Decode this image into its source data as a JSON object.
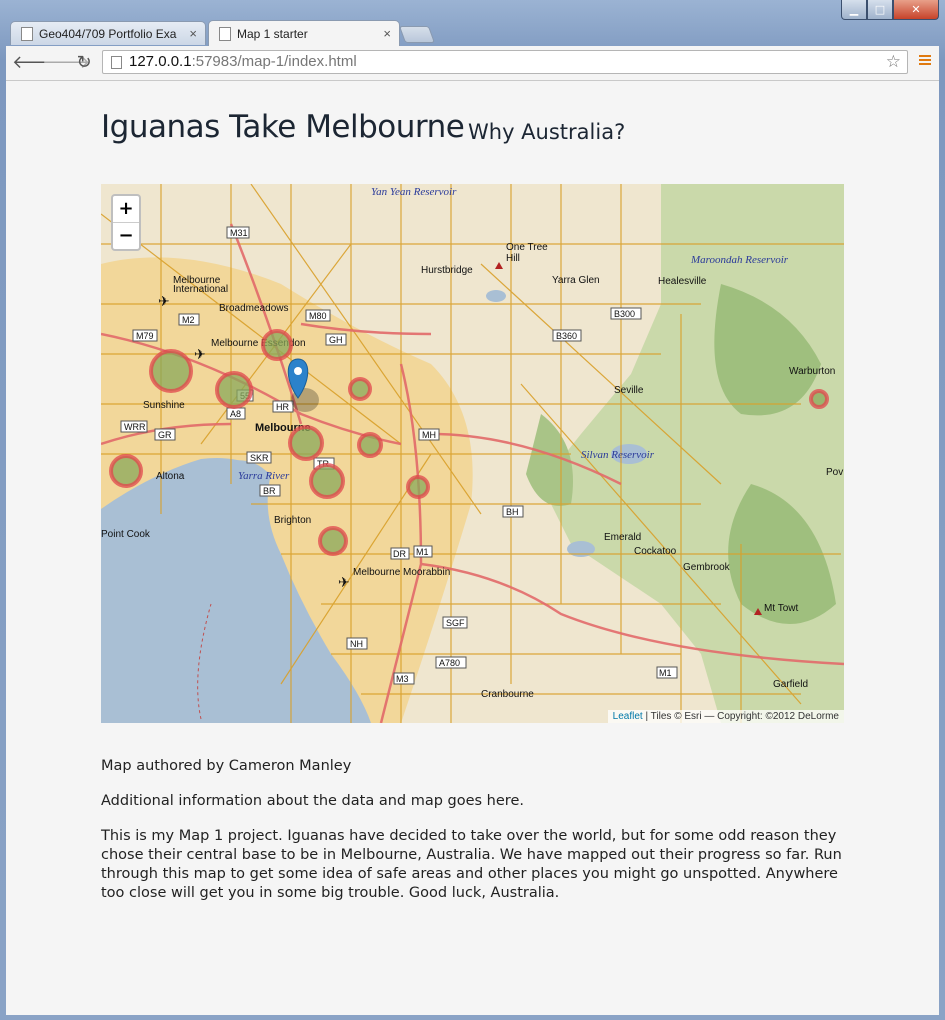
{
  "browser": {
    "tabs": [
      {
        "label": "Geo404/709 Portfolio Exa",
        "close": "×"
      },
      {
        "label": "Map 1 starter",
        "close": "×"
      }
    ],
    "url_host": "127.0.0.1",
    "url_rest": ":57983/map-1/index.html",
    "icons": [
      "back-icon",
      "forward-icon",
      "reload-icon",
      "bookmark-star-icon",
      "menu-icon"
    ]
  },
  "page": {
    "title": "Iguanas Take Melbourne",
    "subtitle": "Why Australia?",
    "zoom_in": "+",
    "zoom_out": "−",
    "attribution_link": "Leaflet",
    "attribution_rest": " | Tiles © Esri — Copyright: ©2012 DeLorme",
    "author": "Map authored by Cameron Manley",
    "info": "Additional information about the data and map goes here.",
    "description": "This is my Map 1 project. Iguanas have decided to take over the world, but for some odd reason they chose their central base to be in Melbourne, Australia. We have mapped out their progress so far. Run through this map to get some idea of safe areas and other places you might go unspotted. Anywhere too close will get you in some big trouble. Good luck, Australia."
  },
  "map_labels": {
    "yan_yean": "Yan Yean Reservoir",
    "maroondah": "Maroondah Reservoir",
    "silvan": "Silvan Reservoir",
    "yarra_river": "Yarra River",
    "one_tree_hill": "One Tree Hill",
    "hurstbridge": "Hurstbridge",
    "yarra_glen": "Yarra Glen",
    "healesville": "Healesville",
    "melbourne_intl": "Melbourne International",
    "broadmeadows": "Broadmeadows",
    "essendon": "Melbourne Essendon",
    "sunshine": "Sunshine",
    "melbourne": "Melbourne",
    "altona": "Altona",
    "point_cook": "Point Cook",
    "brighton": "Brighton",
    "moorabbin": "Melbourne Moorabbin",
    "seville": "Seville",
    "warburton": "Warburton",
    "emerald": "Emerald",
    "cockatoo": "Cockatoo",
    "gembrook": "Gembrook",
    "mt_towt": "Mt Towt",
    "garfield": "Garfield",
    "cranbourne": "Cranbourne",
    "pow": "Pov",
    "roads": [
      "M31",
      "M2",
      "M80",
      "M79",
      "GH",
      "B300",
      "B360",
      "HR",
      "A8",
      "WRR",
      "GR",
      "SKR",
      "TR",
      "MH",
      "BR",
      "BH",
      "DR",
      "M1",
      "SGF",
      "NH",
      "A780",
      "M3",
      "M1",
      "55"
    ]
  },
  "colors": {
    "water": "#a9bfd4",
    "land": "#efe6cf",
    "urban": "#f2d79a",
    "road": "#d9a02a",
    "motorway": "#e26a6a",
    "forest": "#b9cf9a",
    "marker_ring": "#e0474c",
    "marker_fill": "#8aa85a",
    "pin": "#2b82cb"
  }
}
